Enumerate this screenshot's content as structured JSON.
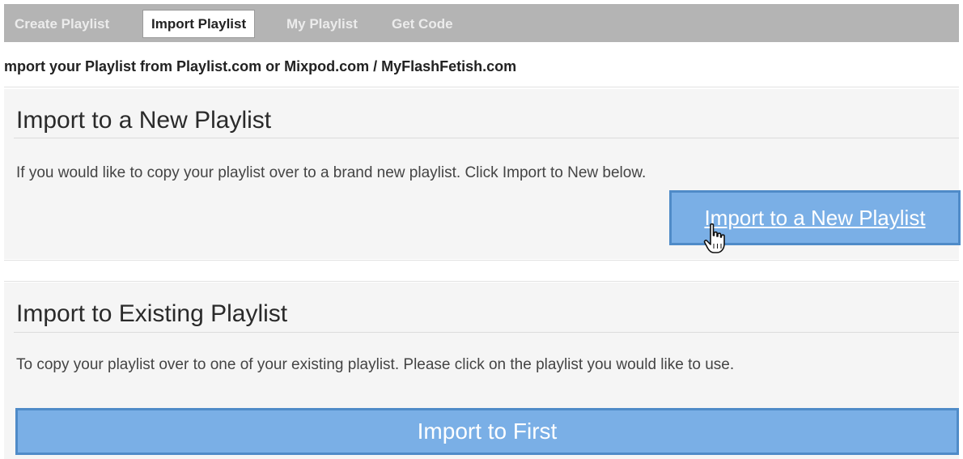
{
  "tabs": [
    {
      "label": "Create Playlist",
      "active": false
    },
    {
      "label": "Import Playlist",
      "active": true
    },
    {
      "label": "My Playlist",
      "active": false
    },
    {
      "label": "Get Code",
      "active": false
    }
  ],
  "subtitle": "mport your Playlist from Playlist.com or Mixpod.com / MyFlashFetish.com",
  "new_section": {
    "title": "Import to a New Playlist",
    "description": "If you would like to copy your playlist over to a brand new playlist. Click Import to New below.",
    "button_label": "Import to a New Playlist"
  },
  "existing_section": {
    "title": "Import to Existing Playlist",
    "description": "To copy your playlist over to one of your existing playlist. Please click on the playlist you would like to use.",
    "button_label": "Import to First"
  },
  "colors": {
    "tab_bar": "#b4b4b4",
    "button_fill": "#7aafe6",
    "button_border": "#4f8bc8",
    "panel_bg": "#f5f5f5"
  },
  "icons": {
    "cursor": "hand-pointer-icon"
  }
}
